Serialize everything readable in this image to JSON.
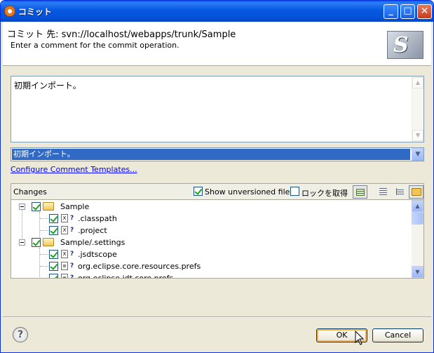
{
  "window": {
    "title": "コミット"
  },
  "header": {
    "title": "コミット 先: svn://localhost/webapps/trunk/Sample",
    "subtitle": "Enter a comment for the commit operation."
  },
  "comment": {
    "text": "初期インポート。"
  },
  "history": {
    "selected": "初期インポート。"
  },
  "links": {
    "configure_templates": "Configure Comment Templates..."
  },
  "changes": {
    "label": "Changes",
    "show_unversioned": {
      "label": "Show unversioned files",
      "checked": true
    },
    "lock": {
      "label": "ロックを取得",
      "checked": false
    },
    "items": [
      {
        "label": "Sample",
        "type": "folder",
        "checked": true,
        "status": ""
      },
      {
        "label": ".classpath",
        "type": "file",
        "checked": true,
        "status": "?"
      },
      {
        "label": ".project",
        "type": "file",
        "checked": true,
        "status": "?"
      },
      {
        "label": "Sample/.settings",
        "type": "folder",
        "checked": true,
        "status": ""
      },
      {
        "label": ".jsdtscope",
        "type": "file",
        "checked": true,
        "status": "?"
      },
      {
        "label": "org.eclipse.core.resources.prefs",
        "type": "file",
        "checked": true,
        "status": "?"
      },
      {
        "label": "org.eclipse.jdt.core.prefs",
        "type": "file",
        "checked": true,
        "status": "?"
      }
    ]
  },
  "buttons": {
    "ok": "OK",
    "cancel": "Cancel",
    "help": "?"
  }
}
